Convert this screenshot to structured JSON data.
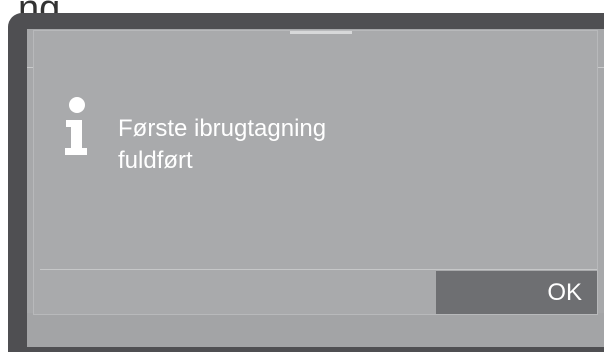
{
  "header": {
    "partial_text": "ng"
  },
  "dialog": {
    "icon": "info-icon",
    "message": "Første ibrugtagning\nfuldført",
    "ok_label": "OK"
  },
  "colors": {
    "frame": "#4f4f52",
    "screen": "#a7a8aa",
    "button": "#6e6f72",
    "text": "#ffffff"
  }
}
